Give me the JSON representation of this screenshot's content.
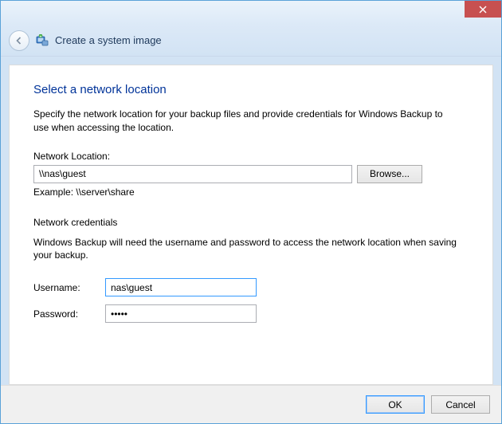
{
  "titlebar": {
    "close_tooltip": "Close"
  },
  "header": {
    "title": "Create a system image"
  },
  "page": {
    "title": "Select a network location",
    "description": "Specify the network location for your backup files and provide credentials for Windows Backup to use when accessing the location.",
    "location_label": "Network Location:",
    "location_value": "\\\\nas\\guest",
    "browse_label": "Browse...",
    "example_text": "Example: \\\\server\\share",
    "credentials_section": "Network credentials",
    "credentials_desc": "Windows Backup will need the username and password to access the network location when saving your backup.",
    "username_label": "Username:",
    "username_value": "nas\\guest",
    "password_label": "Password:",
    "password_value": "•••••"
  },
  "footer": {
    "ok_label": "OK",
    "cancel_label": "Cancel"
  }
}
